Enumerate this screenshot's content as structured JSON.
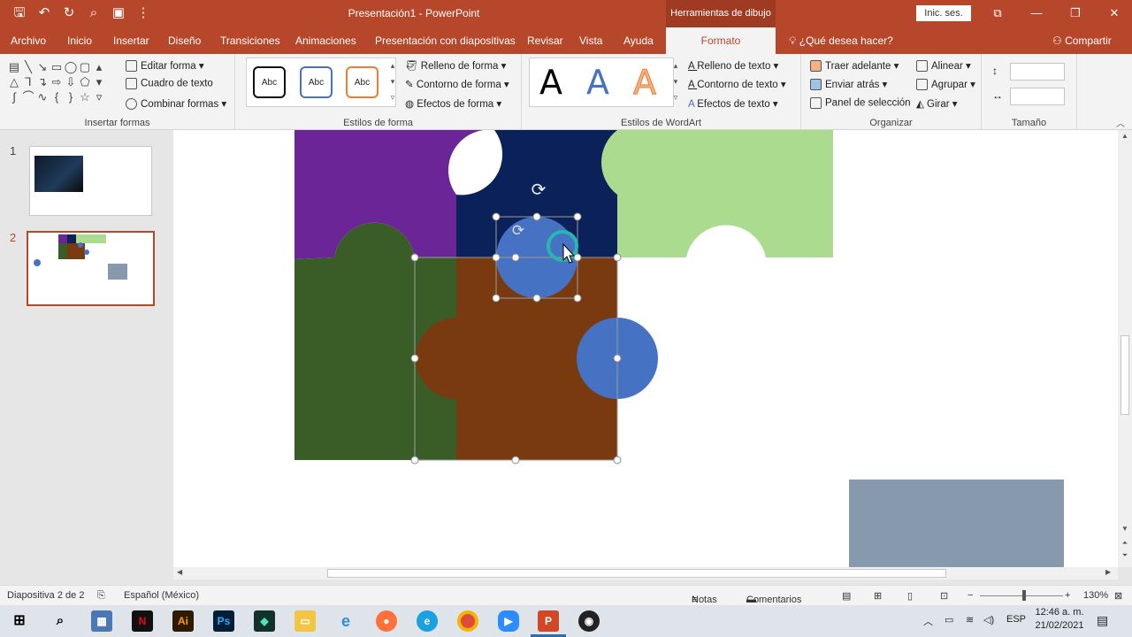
{
  "titlebar": {
    "document_title": "Presentación1 - PowerPoint",
    "context_tab": "Herramientas de dibujo",
    "signin": "Inic. ses.",
    "qat_icons": [
      "save-icon",
      "undo-icon",
      "redo-icon",
      "present-icon",
      "layout-icon",
      "customize-icon"
    ]
  },
  "tabs": {
    "items": [
      "Archivo",
      "Inicio",
      "Insertar",
      "Diseño",
      "Transiciones",
      "Animaciones",
      "Presentación con diapositivas",
      "Revisar",
      "Vista",
      "Ayuda",
      "Formato"
    ],
    "active": "Formato",
    "search": "¿Qué desea hacer?",
    "share": "Compartir"
  },
  "ribbon": {
    "insert_shapes": {
      "label": "Insertar formas",
      "edit_shape": "Editar forma",
      "text_box": "Cuadro de texto",
      "merge_shapes": "Combinar formas"
    },
    "shape_styles": {
      "label": "Estilos de forma",
      "preset": "Abc",
      "fill": "Relleno de forma",
      "outline": "Contorno de forma",
      "effects": "Efectos de forma"
    },
    "wordart": {
      "label": "Estilos de WordArt",
      "letter": "A",
      "text_fill": "Relleno de texto",
      "text_outline": "Contorno de texto",
      "text_effects": "Efectos de texto"
    },
    "arrange": {
      "label": "Organizar",
      "bring_forward": "Traer adelante",
      "send_backward": "Enviar atrás",
      "selection_pane": "Panel de selección",
      "align": "Alinear",
      "group": "Agrupar",
      "rotate": "Girar"
    },
    "size": {
      "label": "Tamaño"
    }
  },
  "thumbnails": [
    {
      "number": "1",
      "selected": false
    },
    {
      "number": "2",
      "selected": true
    }
  ],
  "colors": {
    "accent": "#b7472a",
    "purple": "#6b2596",
    "navy": "#0b2159",
    "light_green": "#abdb8f",
    "dark_green": "#3a5d28",
    "brown": "#7a3a10",
    "blue": "#4672c4",
    "gray_blue": "#8799ad"
  },
  "status": {
    "slide_info": "Diapositiva 2 de 2",
    "language": "Español (México)",
    "notes": "Notas",
    "comments": "Comentarios",
    "zoom": "130%"
  },
  "taskbar": {
    "apps": [
      "windows-icon",
      "search-icon",
      "calculator-icon",
      "netflix-icon",
      "illustrator-icon",
      "photoshop-icon",
      "app-icon",
      "file-explorer-icon",
      "ie-icon",
      "firefox-icon",
      "edge-icon",
      "chrome-icon",
      "zoom-icon",
      "powerpoint-icon",
      "media-icon"
    ],
    "lang": "ESP",
    "time": "12:46 a. m.",
    "date": "21/02/2021"
  }
}
